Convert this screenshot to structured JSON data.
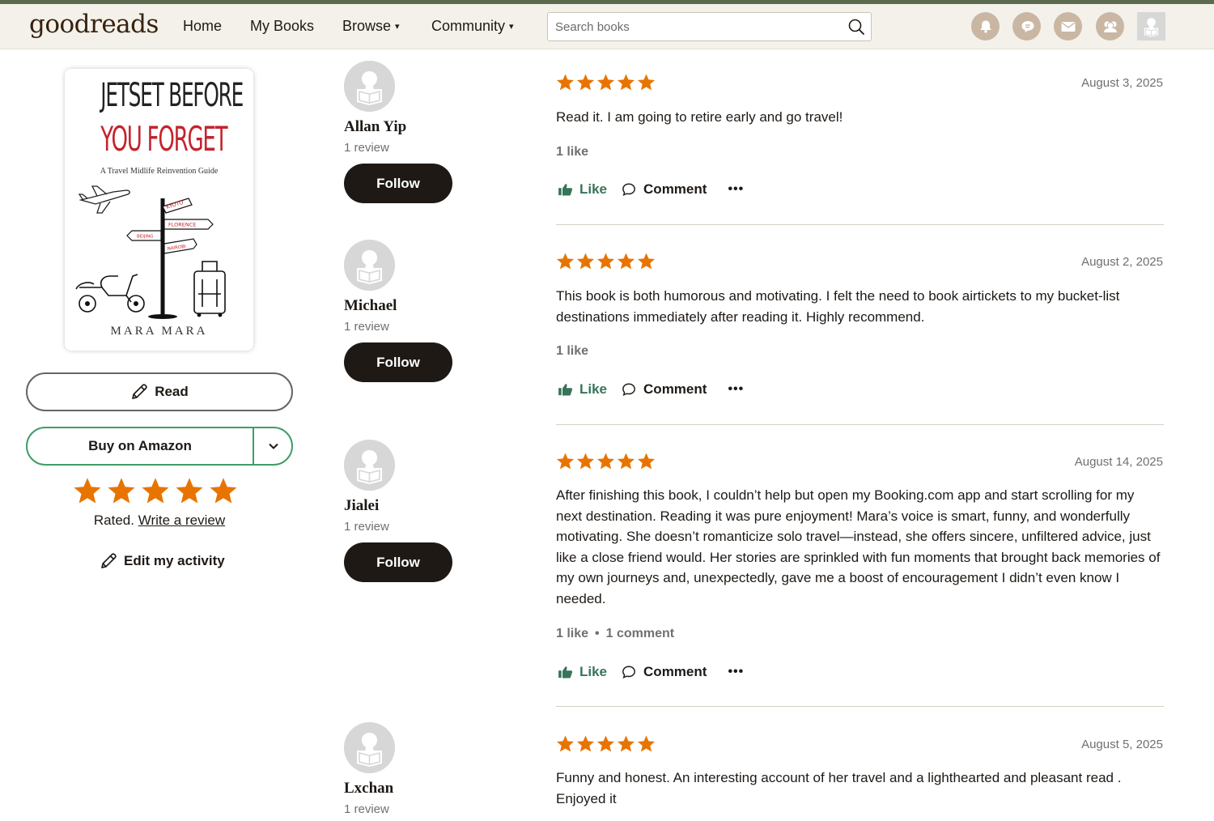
{
  "header": {
    "logo": "goodreads",
    "nav": [
      {
        "label": "Home"
      },
      {
        "label": "My Books"
      },
      {
        "label": "Browse",
        "caret": "▾"
      },
      {
        "label": "Community",
        "caret": "▾"
      }
    ],
    "search": {
      "placeholder": "Search books",
      "value": ""
    },
    "icons": [
      "notifications-icon",
      "discussions-icon",
      "messages-icon",
      "friends-icon",
      "profile-icon"
    ]
  },
  "book": {
    "cover": {
      "title_line1": "JETSET BEFORE",
      "title_line2": "YOU FORGET",
      "subtitle": "A Travel Midlife Reinvention Guide",
      "author": "MARA MARA",
      "signposts": [
        "KYOTO",
        "FLORENCE",
        "BEIJING",
        "NAIROBI"
      ]
    },
    "read_button": "Read",
    "buy_button": "Buy on Amazon",
    "user_rating": 5,
    "rated_text": "Rated.",
    "write_review": "Write a review",
    "edit_activity": "Edit my activity"
  },
  "reviews": [
    {
      "name": "Allan Yip",
      "review_count": "1 review",
      "follow": "Follow",
      "rating": 5,
      "date": "August 3, 2025",
      "text": "Read it. I am going to retire early and go travel!",
      "likes": "1 like",
      "comments": "",
      "like_label": "Like",
      "comment_label": "Comment",
      "more_label": "•••"
    },
    {
      "name": "Michael",
      "review_count": "1 review",
      "follow": "Follow",
      "rating": 5,
      "date": "August 2, 2025",
      "text": "This book is both humorous and motivating. I felt the need to book airtickets to my bucket-list destinations immediately after reading it. Highly recommend.",
      "likes": "1 like",
      "comments": "",
      "like_label": "Like",
      "comment_label": "Comment",
      "more_label": "•••"
    },
    {
      "name": "Jialei",
      "review_count": "1 review",
      "follow": "Follow",
      "rating": 5,
      "date": "August 14, 2025",
      "text": "After finishing this book, I couldn’t help but open my Booking.com app and start scrolling for my next destination. Reading it was pure enjoyment! Mara’s voice is smart, funny, and wonderfully motivating. She doesn’t romanticize solo travel—instead, she offers sincere, unfiltered advice, just like a close friend would. Her stories are sprinkled with fun moments that brought back memories of my own journeys and, unexpectedly, gave me a boost of encouragement I didn’t even know I needed.",
      "likes": "1 like",
      "dot": "•",
      "comments": "1 comment",
      "like_label": "Like",
      "comment_label": "Comment",
      "more_label": "•••"
    },
    {
      "name": "Lxchan",
      "review_count": "1 review",
      "follow": "Follow",
      "rating": 5,
      "date": "August 5, 2025",
      "text": "Funny and honest. An interesting account of her travel and a lighthearted and pleasant read . Enjoyed it"
    }
  ],
  "colors": {
    "brand_brown": "#382110",
    "header_bg": "#f4f1ea",
    "star_orange": "#e87400",
    "buy_green": "#409d69",
    "like_green": "#377458",
    "follow_dark": "#1e1915",
    "header_icon": "#c9b7a3",
    "top_accent": "#5a6b4e"
  }
}
